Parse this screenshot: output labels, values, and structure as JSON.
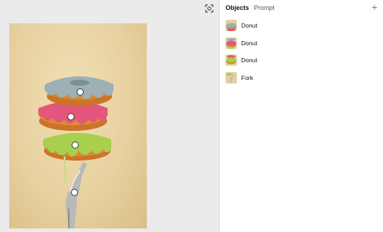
{
  "panel": {
    "tabs": [
      {
        "label": "Objects",
        "active": true
      },
      {
        "label": "Prompt",
        "active": false
      }
    ],
    "add_label": "+",
    "objects": [
      {
        "label": "Donut",
        "icon": "donut-blue"
      },
      {
        "label": "Donut",
        "icon": "donut-pink"
      },
      {
        "label": "Donut",
        "icon": "donut-green"
      },
      {
        "label": "Fork",
        "icon": "fork"
      }
    ]
  },
  "canvas": {
    "focus_icon": "focus-frame-icon",
    "colors": {
      "background": "#e8d1a0",
      "donut_blue_glaze": "#9aaeb3",
      "donut_pink_glaze": "#e2567a",
      "donut_green_glaze": "#a6cd4a",
      "donut_dough": "#d77f2d",
      "fork": "#bdbdbd"
    }
  }
}
